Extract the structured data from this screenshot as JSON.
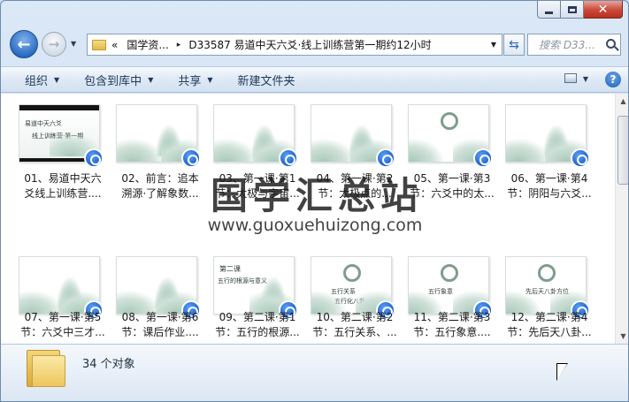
{
  "window": {
    "caption": {
      "close_glyph": "✕"
    }
  },
  "nav": {
    "back_icon": "arrow-left",
    "forward_icon": "arrow-right",
    "address": {
      "parts": [
        "«",
        "国学资...",
        "▸",
        "D33587 易道中天六爻·线上训练营第一期约12小时"
      ]
    },
    "search_placeholder": "搜索 D33..."
  },
  "command_bar": {
    "organize": "组织",
    "include_in_library": "包含到库中",
    "share": "共享",
    "new_folder": "新建文件夹"
  },
  "items": [
    {
      "line1": "01、易道中天六",
      "line2": "爻线上训练营....",
      "thumb_style": "cover",
      "cover_title": "易道中天六爻",
      "cover_sub": "线上训练营·第一期"
    },
    {
      "line1": "02、前言：追本",
      "line2": "溯源·了解象数...",
      "thumb_style": "blank"
    },
    {
      "line1": "03、第一课·第1",
      "line2": "节：太极与宇宙...",
      "thumb_style": "landscape"
    },
    {
      "line1": "04、第一课·第2",
      "line2": "节：太极点的...",
      "thumb_style": "landscape"
    },
    {
      "line1": "05、第一课·第3",
      "line2": "节：六爻中的太...",
      "thumb_style": "seal"
    },
    {
      "line1": "06、第一课·第4",
      "line2": "节：阴阳与六爻...",
      "thumb_style": "landscape"
    },
    {
      "line1": "07、第一课·第5",
      "line2": "节：六爻中三才...",
      "thumb_style": "landscape"
    },
    {
      "line1": "08、第一课·第6",
      "line2": "节：课后作业....",
      "thumb_style": "landscape"
    },
    {
      "line1": "09、第二课·第1",
      "line2": "节：五行的根源...",
      "thumb_style": "text",
      "cover_title": "第二课",
      "cover_sub": "五行的根源与意义"
    },
    {
      "line1": "10、第二课·第2",
      "line2": "节：五行关系、...",
      "thumb_style": "seal",
      "cover_title": "五行关系",
      "cover_sub": "五行化八卦"
    },
    {
      "line1": "11、第二课·第3",
      "line2": "节：五行象意....",
      "thumb_style": "seal",
      "cover_title": "五行象意"
    },
    {
      "line1": "12、第二课·第4",
      "line2": "节：先后天八卦...",
      "thumb_style": "seal",
      "cover_title": "先后天八卦方位"
    }
  ],
  "watermark": {
    "text": "国学汇总站",
    "url": "www.guoxuehuizong.com"
  },
  "details": {
    "count": "34 个对象"
  }
}
